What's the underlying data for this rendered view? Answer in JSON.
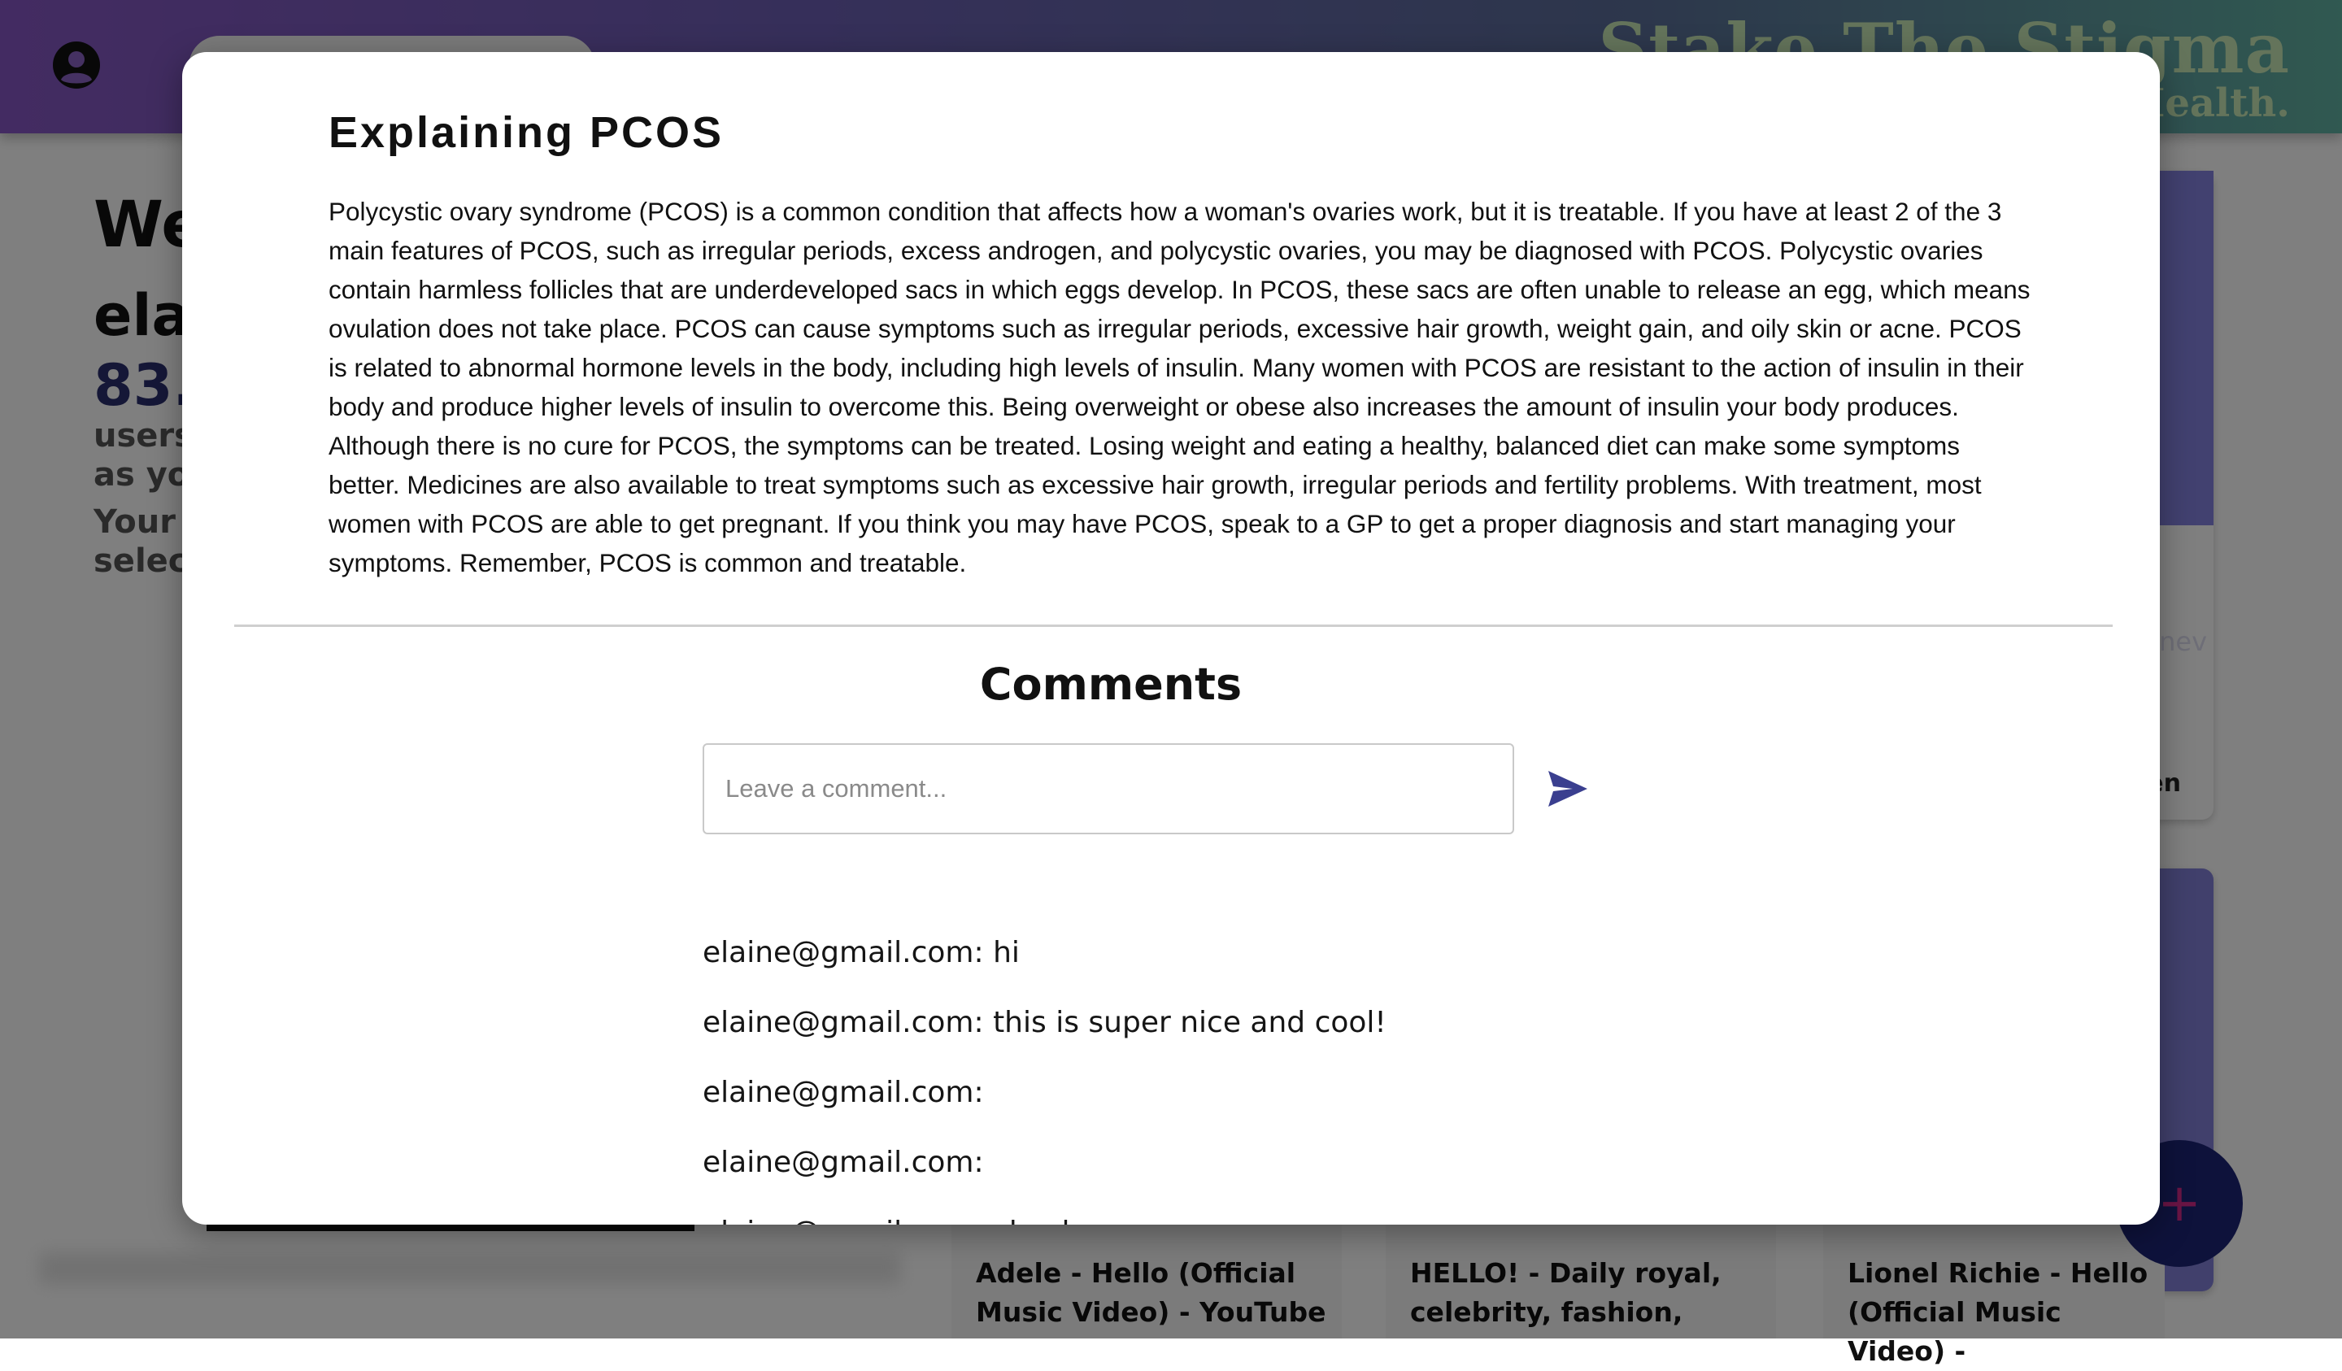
{
  "colors": {
    "header_gradient": [
      "#8757c4",
      "#5a6e98",
      "#60b2a2"
    ],
    "brand_text": "#c9e8b6",
    "accent": "#2b2f6e",
    "send_icon": "#3a3f8f",
    "fab": "#1d2477"
  },
  "header": {
    "avatar_icon": "user-circle-icon",
    "brand_title": "Stake The Stigma",
    "brand_subtitle": "Health."
  },
  "background": {
    "welcome_line1": "We",
    "user_name": "ela",
    "percentage": "83.",
    "users_line": "users",
    "as_you_line": "as yo",
    "your_line": "Your",
    "select_line": "selec",
    "right_card_fragment1": "d nev",
    "right_card_fragment2": "en",
    "videos": [
      {
        "title": "Adele - Hello (Official Music Video) - YouTube"
      },
      {
        "title": "HELLO! - Daily royal, celebrity, fashion,"
      },
      {
        "title": "Lionel Richie - Hello (Official Music Video) -"
      }
    ],
    "fab_icon": "plus-icon",
    "fab_label": "+"
  },
  "modal": {
    "title": "Explaining PCOS",
    "body": "Polycystic ovary syndrome (PCOS) is a common condition that affects how a woman's ovaries work, but it is treatable. If you have at least 2 of the 3 main features of PCOS, such as irregular periods, excess androgen, and polycystic ovaries, you may be diagnosed with PCOS. Polycystic ovaries contain harmless follicles that are underdeveloped sacs in which eggs develop. In PCOS, these sacs are often unable to release an egg, which means ovulation does not take place. PCOS can cause symptoms such as irregular periods, excessive hair growth, weight gain, and oily skin or acne. PCOS is related to abnormal hormone levels in the body, including high levels of insulin. Many women with PCOS are resistant to the action of insulin in their body and produce higher levels of insulin to overcome this. Being overweight or obese also increases the amount of insulin your body produces. Although there is no cure for PCOS, the symptoms can be treated. Losing weight and eating a healthy, balanced diet can make some symptoms better. Medicines are also available to treat symptoms such as excessive hair growth, irregular periods and fertility problems. With treatment, most women with PCOS are able to get pregnant. If you think you may have PCOS, speak to a GP to get a proper diagnosis and start managing your symptoms. Remember, PCOS is common and treatable.",
    "comments_heading": "Comments",
    "comment_input": {
      "placeholder": "Leave a comment...",
      "value": ""
    },
    "send_icon": "send-icon",
    "comments": [
      "elaine@gmail.com: hi",
      "elaine@gmail.com: this is super nice and cool!",
      "elaine@gmail.com:",
      "elaine@gmail.com:",
      "elaine@gmail.com: check"
    ]
  }
}
